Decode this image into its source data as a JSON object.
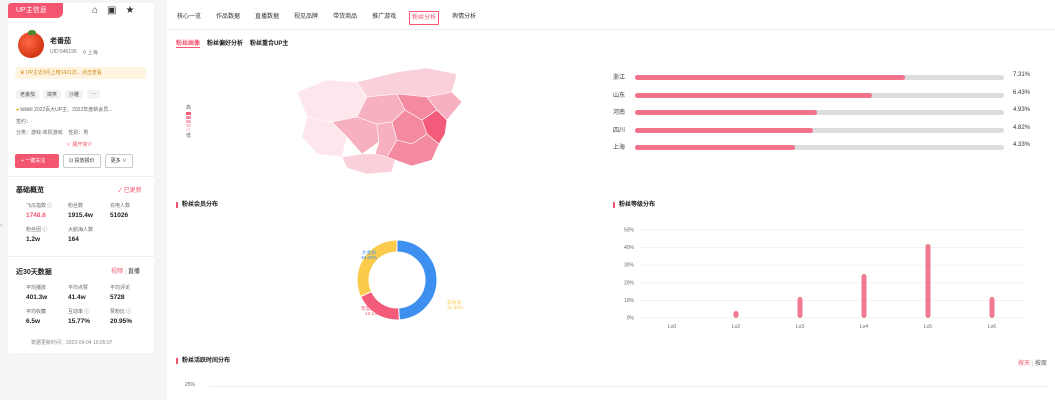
{
  "left": {
    "tab_label": "UP主信息",
    "icons": [
      "home-icon",
      "tv-icon",
      "star-icon"
    ],
    "nickname": "老番茄",
    "uid": "UID:546195",
    "location": "上海",
    "notice": "UP主近3月上榜1421次，点击查看",
    "tags": [
      "老番茄",
      "搞笑",
      "沙雕",
      "···"
    ],
    "bio": "bilibili 2022百大UP主、2022年度新会员...",
    "sign_label": "签约：",
    "sign_value": "-",
    "category_label": "分类：",
    "category_value": "游戏-单机游戏",
    "gender_label": "性别：",
    "gender_value": "男",
    "expand": "∨ 展开简介",
    "btn_follow": "+ 一键关注",
    "btn_report": "投放报价",
    "btn_more": "更多",
    "basic_title": "基础概览",
    "basic_update": "✓ 已更新",
    "basic_stats": [
      {
        "label": "飞瓜指数 ⓘ",
        "value": "1748.6",
        "pink": true
      },
      {
        "label": "粉丝数",
        "value": "1915.4w"
      },
      {
        "label": "充电人数",
        "value": "51026"
      },
      {
        "label": "粉丝团 ⓘ",
        "value": "1.2w"
      },
      {
        "label": "大航海人数",
        "value": "164"
      }
    ],
    "recent_title": "近30天数据",
    "recent_toggle_on": "视频",
    "recent_toggle_off": "直播",
    "recent_stats": [
      {
        "label": "平均播放",
        "value": "401.3w"
      },
      {
        "label": "平均点赞",
        "value": "41.4w"
      },
      {
        "label": "平均评论",
        "value": "5728"
      },
      {
        "label": "平均收藏",
        "value": "6.5w"
      },
      {
        "label": "互动率 ⓘ",
        "value": "15.77%"
      },
      {
        "label": "赞粉比 ⓘ",
        "value": "20.95%"
      }
    ],
    "update_time": "数据更新时间：2023-09-04 10:05:07"
  },
  "main": {
    "tabs": [
      {
        "label": "核心一览",
        "active": false
      },
      {
        "label": "作品数据",
        "active": false
      },
      {
        "label": "直播数据",
        "active": false
      },
      {
        "label": "视见品牌",
        "active": false
      },
      {
        "label": "带货商品",
        "active": false
      },
      {
        "label": "推广游戏",
        "active": false
      },
      {
        "label": "粉丝分析",
        "active": true
      },
      {
        "label": "舆情分析",
        "active": false
      }
    ],
    "subtabs": [
      {
        "label": "粉丝画像",
        "active": true
      },
      {
        "label": "粉丝偏好分析",
        "active": false
      },
      {
        "label": "粉丝重合UP主",
        "active": false
      }
    ],
    "map_legend_high": "高",
    "map_legend_low": "低",
    "map_legend_colors": [
      "#f25c7a",
      "#f48aa0",
      "#f7b0bf",
      "#fad0da",
      "#fde6ec"
    ],
    "provinces": [
      {
        "name": "浙江",
        "pct": "7.31%",
        "value": 7.31
      },
      {
        "name": "山东",
        "pct": "6.43%",
        "value": 6.43
      },
      {
        "name": "河南",
        "pct": "4.93%",
        "value": 4.93
      },
      {
        "name": "四川",
        "pct": "4.82%",
        "value": 4.82
      },
      {
        "name": "上海",
        "pct": "4.33%",
        "value": 4.33
      }
    ],
    "member_title": "粉丝会员分布",
    "level_title": "粉丝等级分布",
    "activity_title": "粉丝活跃时间分布",
    "activity_toggle_on": "按天",
    "activity_toggle_off": "按周",
    "activity_axis_top": "25%"
  },
  "chart_data": [
    {
      "type": "pie",
      "title": "粉丝会员分布",
      "categories": [
        "大会员",
        "年度大会员",
        "非会员"
      ],
      "values": [
        49.06,
        19.14,
        31.8
      ],
      "colors": [
        "#3d8ff0",
        "#f25c7a",
        "#fbcb4c"
      ]
    },
    {
      "type": "bar",
      "title": "粉丝等级分布",
      "categories": [
        "Lv0",
        "Lv2",
        "Lv3",
        "Lv4",
        "Lv5",
        "Lv6"
      ],
      "values": [
        0,
        4,
        12,
        25,
        42,
        12
      ],
      "ylim": [
        0,
        50
      ],
      "yticks": [
        "0%",
        "10%",
        "20%",
        "30%",
        "40%",
        "50%"
      ],
      "color": "#ef7a90"
    }
  ]
}
